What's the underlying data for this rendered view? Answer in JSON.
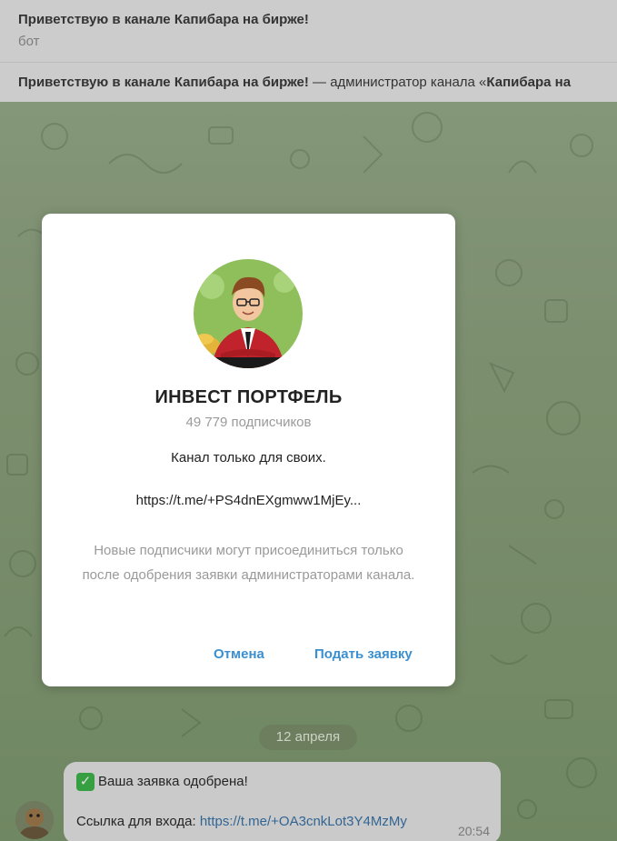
{
  "header": {
    "title": "Приветствую в канале Капибара на бирже!",
    "subtitle": "бот"
  },
  "pinned": {
    "bold_start": "Приветствую в канале Капибара на бирже!",
    "middle": " — администратор канала «",
    "bold_end": "Капибара на"
  },
  "modal": {
    "channel_name": "ИНВЕСТ ПОРТФЕЛЬ",
    "subscribers": "49 779 подписчиков",
    "description": "Канал только для своих.",
    "link": "https://t.me/+PS4dnEXgmww1MjEy...",
    "note": "Новые подписчики могут присоединиться только после одобрения заявки администраторами канала.",
    "cancel_label": "Отмена",
    "submit_label": "Подать заявку"
  },
  "chat": {
    "date": "12 апреля",
    "message": {
      "check_emoji": "✓",
      "line1": "Ваша заявка одобрена!",
      "link_prefix": "Ссылка для входа: ",
      "link": "https://t.me/+OA3cnkLot3Y4MzMy",
      "time": "20:54"
    }
  },
  "colors": {
    "accent": "#3a8fd0",
    "wallpaper": "#8ea37f",
    "bubble": "#e6e6e6"
  }
}
